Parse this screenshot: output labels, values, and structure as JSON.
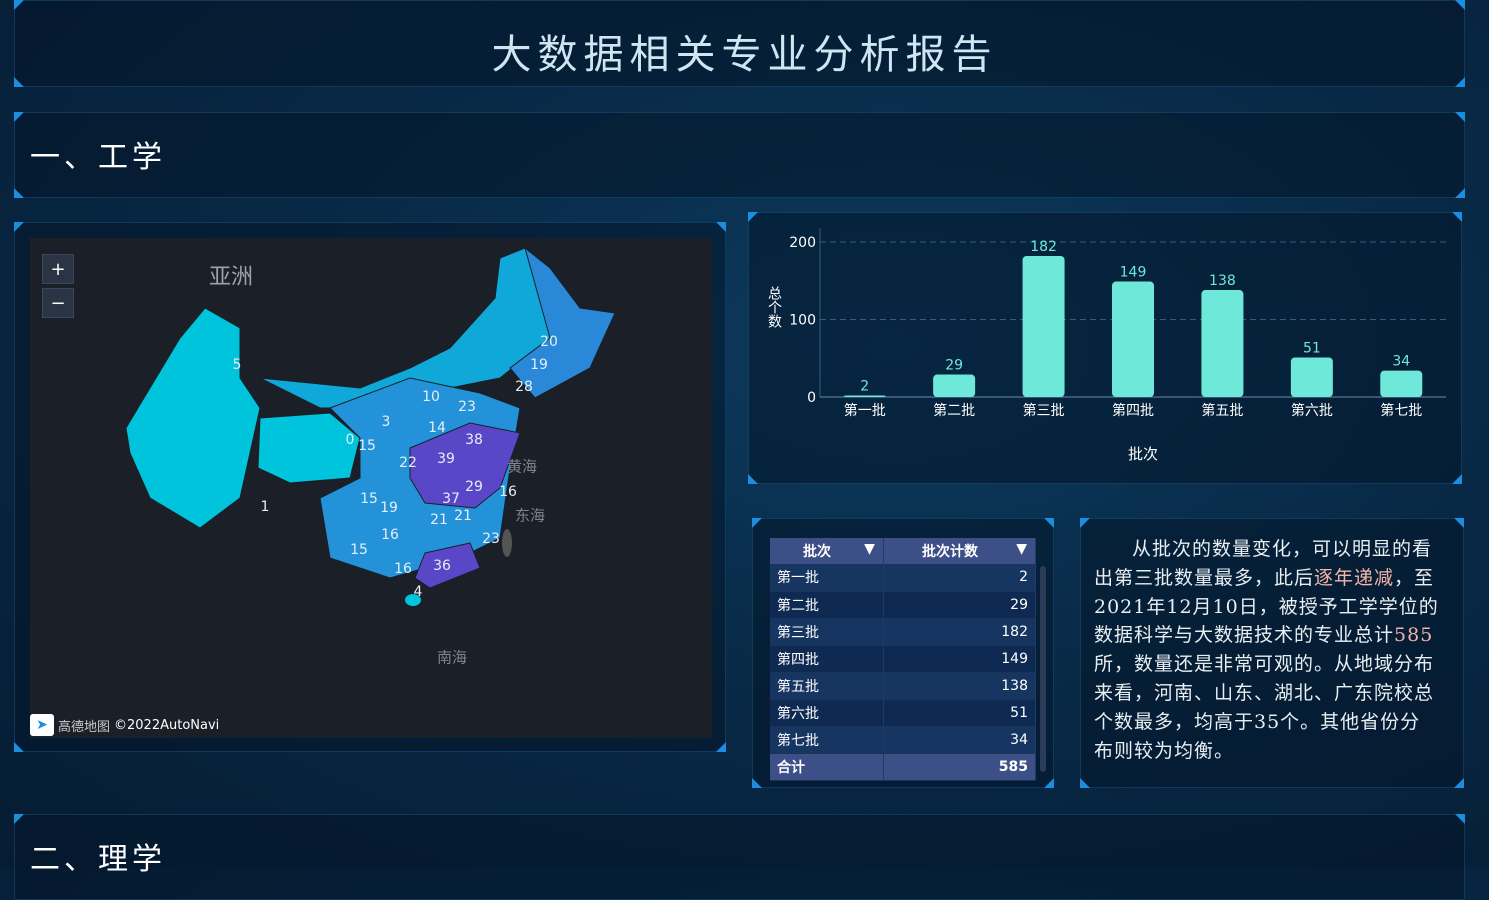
{
  "header": {
    "title": "大数据相关专业分析报告"
  },
  "sections": [
    {
      "title": "一、工学"
    },
    {
      "title": "二、理学"
    }
  ],
  "map": {
    "zoom_in": "+",
    "zoom_out": "−",
    "continent_label": "亚洲",
    "sea_labels": [
      "黄海",
      "东海",
      "南海"
    ],
    "attribution": "©2022AutoNavi",
    "logo_text": "高德地图",
    "province_values": [
      "5",
      "1",
      "0",
      "15",
      "3",
      "10",
      "23",
      "14",
      "38",
      "22",
      "39",
      "29",
      "16",
      "37",
      "15",
      "19",
      "21",
      "21",
      "16",
      "23",
      "15",
      "16",
      "36",
      "4",
      "20",
      "19",
      "28"
    ],
    "colors": {
      "low": "#00c4dc",
      "mid": "#2492d8",
      "high": "#5a47c8"
    }
  },
  "chart_data": {
    "type": "bar",
    "categories": [
      "第一批",
      "第二批",
      "第三批",
      "第四批",
      "第五批",
      "第六批",
      "第七批"
    ],
    "values": [
      2,
      29,
      182,
      149,
      138,
      51,
      34
    ],
    "xlabel": "批次",
    "ylabel": "总个数",
    "ylim": [
      0,
      200
    ],
    "yticks": [
      0,
      100,
      200
    ],
    "color": "#6ee8d9",
    "grid": true
  },
  "table": {
    "headers": [
      "批次",
      "批次计数"
    ],
    "rows": [
      [
        "第一批",
        "2"
      ],
      [
        "第二批",
        "29"
      ],
      [
        "第三批",
        "182"
      ],
      [
        "第四批",
        "149"
      ],
      [
        "第五批",
        "138"
      ],
      [
        "第六批",
        "51"
      ],
      [
        "第七批",
        "34"
      ]
    ],
    "total": [
      "合计",
      "585"
    ]
  },
  "description": {
    "p1": "从批次的数量变化，可以明显的看出第三批数量最多，此后",
    "h1": "逐年递减",
    "p2": "，至2021年12月10日，被授予工学学位的数据科学与大数据技术的专业总计",
    "h2": "585",
    "p3": "所，数量还是非常可观的。从地域分布来看，河南、山东、湖北、广东院校总个数最多，均高于35个。其他省份分布则较为均衡。"
  }
}
